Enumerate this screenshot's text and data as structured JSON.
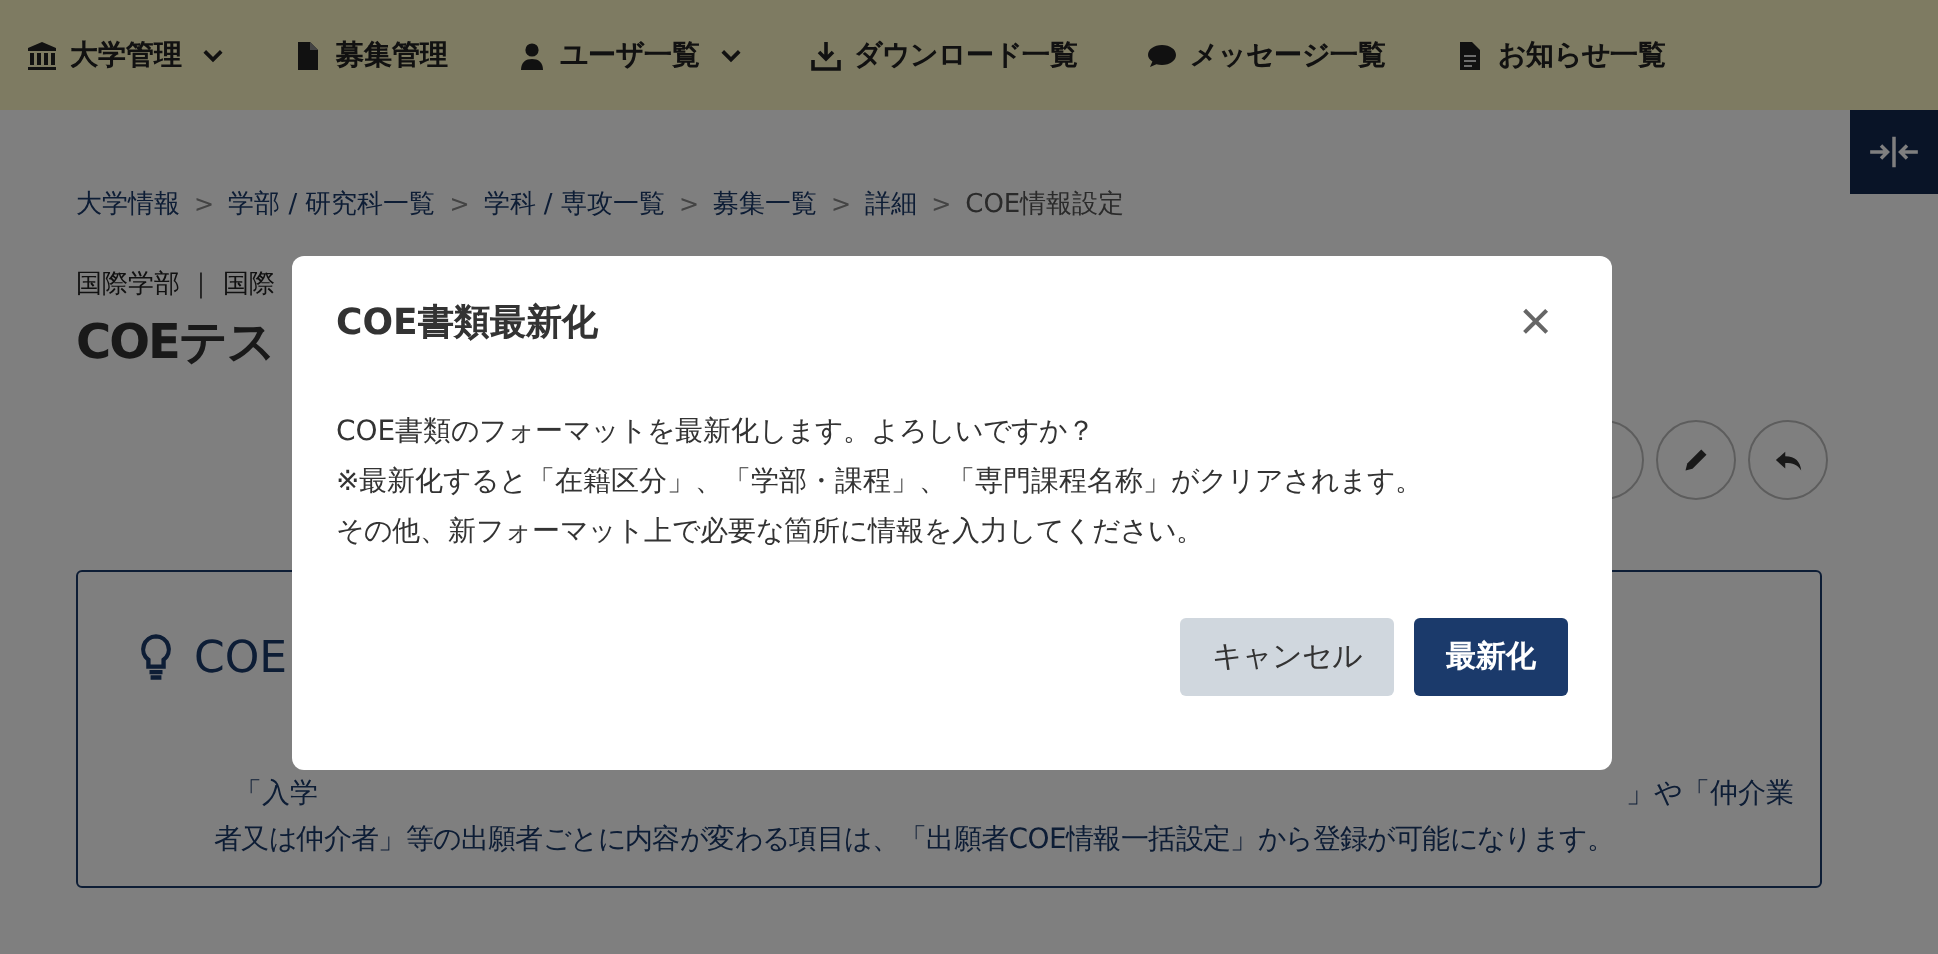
{
  "nav": {
    "items": [
      {
        "kind": "bank",
        "label": "大学管理",
        "dropdown": true
      },
      {
        "kind": "file",
        "label": "募集管理",
        "dropdown": false
      },
      {
        "kind": "user",
        "label": "ユーザ一覧",
        "dropdown": true
      },
      {
        "kind": "download",
        "label": "ダウンロード一覧",
        "dropdown": false
      },
      {
        "kind": "chat",
        "label": "メッセージ一覧",
        "dropdown": false
      },
      {
        "kind": "doc",
        "label": "お知らせ一覧",
        "dropdown": false
      }
    ]
  },
  "breadcrumb": [
    "大学情報",
    "学部 / 研究科一覧",
    "学科 / 専攻一覧",
    "募集一覧",
    "詳細",
    "COE情報設定"
  ],
  "breadcrumb_separator": ">",
  "department": "国際学部 ｜ 国際",
  "page_title": "COEテス",
  "info": {
    "title": "COE",
    "line_1_start": "「入学",
    "line_1_end": "」や「仲介業",
    "line_2": "者又は仲介者」等の出願者ごとに内容が変わる項目は、「出願者COE情報一括設定」から登録が可能になります。"
  },
  "dialog": {
    "title": "COE書類最新化",
    "close": "×",
    "lines": [
      "COE書類のフォーマットを最新化します。よろしいですか？",
      "※最新化すると「在籍区分」、「学部・課程」、「専門課程名称」がクリアされます。",
      "その他、新フォーマット上で必要な箇所に情報を入力してください。"
    ],
    "buttons": [
      {
        "label": "キャンセル",
        "kind": "secondary"
      },
      {
        "label": "最新化",
        "kind": "primary"
      }
    ]
  }
}
